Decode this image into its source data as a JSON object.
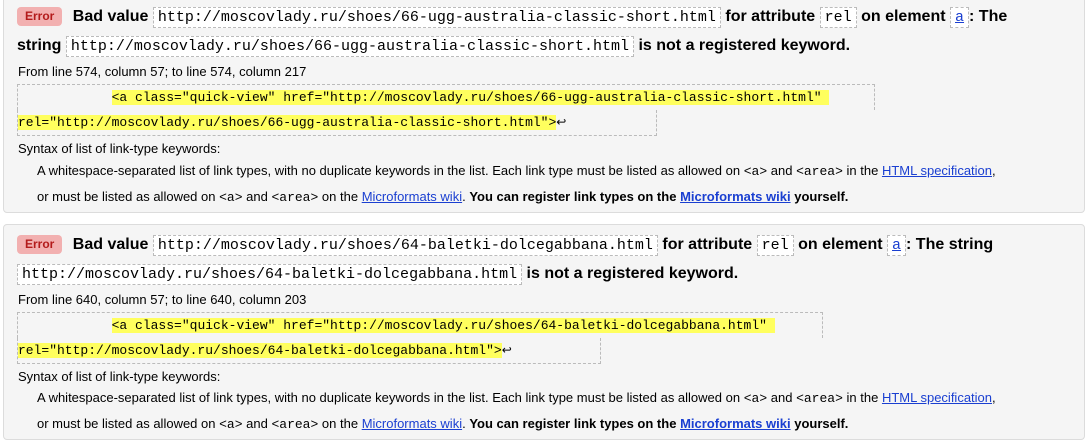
{
  "messages": [
    {
      "badge": "Error",
      "bad_value_label": "Bad value",
      "value": "http://moscovlady.ru/shoes/66-ugg-australia-classic-short.html",
      "for_attribute_label": "for attribute",
      "attribute": "rel",
      "on_element_label": "on element",
      "element": "a",
      "colon_the": ": The",
      "string_label": "string",
      "string_value": "http://moscovlady.ru/shoes/66-ugg-australia-classic-short.html",
      "not_registered": "is not a registered keyword.",
      "location": "From line 574, column 57; to line 574, column 217",
      "extract_indent": "            ",
      "extract_line1": "<a class=\"quick-view\" href=\"http://moscovlady.ru/shoes/66-ugg-australia-classic-short.html\" ",
      "extract_line2": "rel=\"http://moscovlady.ru/shoes/66-ugg-australia-classic-short.html\">",
      "return_glyph": "↩"
    },
    {
      "badge": "Error",
      "bad_value_label": "Bad value",
      "value": "http://moscovlady.ru/shoes/64-baletki-dolcegabbana.html",
      "for_attribute_label": "for attribute",
      "attribute": "rel",
      "on_element_label": "on element",
      "element": "a",
      "colon_the": ": The string",
      "string_label": "",
      "string_value": "http://moscovlady.ru/shoes/64-baletki-dolcegabbana.html",
      "not_registered": "is not a registered keyword.",
      "location": "From line 640, column 57; to line 640, column 203",
      "extract_indent": "            ",
      "extract_line1": "<a class=\"quick-view\" href=\"http://moscovlady.ru/shoes/64-baletki-dolcegabbana.html\" ",
      "extract_line2": "rel=\"http://moscovlady.ru/shoes/64-baletki-dolcegabbana.html\">",
      "return_glyph": "↩"
    }
  ],
  "syntax": {
    "heading": "Syntax of list of link-type keywords:",
    "text1": "A whitespace-separated list of link types, with no duplicate keywords in the list. Each link type must be listed as allowed on",
    "code_a": "<a>",
    "and": "and",
    "code_area": "<area>",
    "in_the": "in the",
    "html_spec_link": "HTML specification",
    "comma": ",",
    "text2": "or must be listed as allowed on",
    "on_the": "on the",
    "microformats_link": "Microformats wiki",
    "period": ".",
    "register_text": "You can register link types on the",
    "microformats_link_bold": "Microformats wiki",
    "yourself": "yourself."
  },
  "colors": {
    "badge_bg": "#f2b0b0",
    "badge_text": "#b31b1b",
    "highlight": "#ffff5e",
    "link": "#1a3fd1"
  }
}
